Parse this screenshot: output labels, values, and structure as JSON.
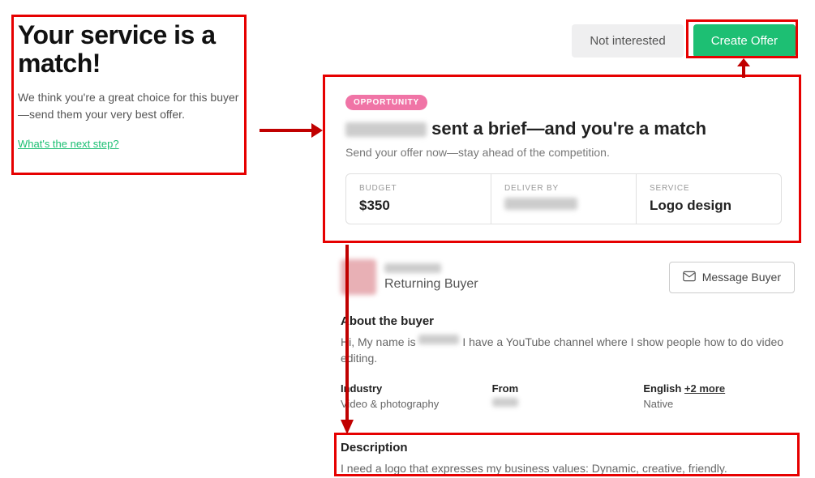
{
  "left": {
    "title": "Your service is a match!",
    "subtitle": "We think you're a great choice for this buyer—send them your very best offer.",
    "next_step": "What's the next step?"
  },
  "actions": {
    "not_interested": "Not interested",
    "create_offer": "Create  Offer"
  },
  "opportunity": {
    "badge": "OPPORTUNITY",
    "title_suffix": " sent a brief—and you're a match",
    "subtitle": "Send your offer now—stay ahead of the competition.",
    "metrics": {
      "budget_label": "BUDGET",
      "budget_value": "$350",
      "deliver_label": "DELIVER BY",
      "deliver_value": "████████",
      "service_label": "SERVICE",
      "service_value": "Logo design"
    }
  },
  "buyer": {
    "tag": "Returning Buyer",
    "message_btn": "Message Buyer",
    "about_title": "About the buyer",
    "about_text_prefix": "Hi, My name is ",
    "about_text_suffix": " I have a YouTube channel where I show people how to do video editing.",
    "attrs": {
      "industry_label": "Industry",
      "industry_value": "Video & photography",
      "from_label": "From",
      "from_value": "███",
      "lang_label": "English",
      "lang_more": "+2 more",
      "lang_value": "Native"
    }
  },
  "description": {
    "title": "Description",
    "text": "I need a logo that expresses my business values: Dynamic, creative, friendly."
  }
}
